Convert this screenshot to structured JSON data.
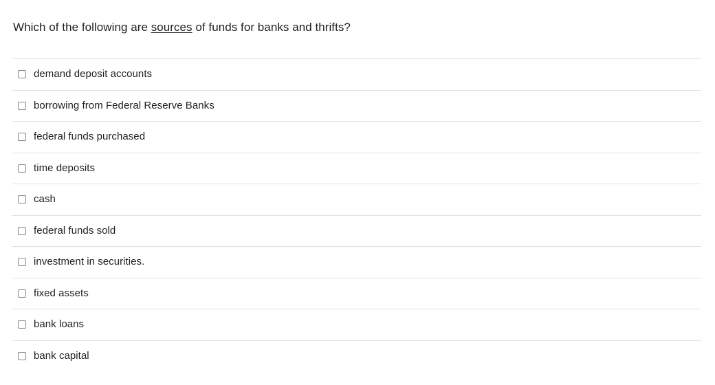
{
  "question": {
    "prefix": "Which of the following are ",
    "emphasis": "sources",
    "suffix": " of funds for banks and thrifts?"
  },
  "colors": {
    "background": "#ffffff",
    "text": "#201f1e",
    "divider": "#e1e1e1",
    "checkbox_border": "#8a8886"
  },
  "options": [
    {
      "label": "demand deposit accounts",
      "checked": false
    },
    {
      "label": "borrowing from Federal Reserve Banks",
      "checked": false
    },
    {
      "label": "federal funds purchased",
      "checked": false
    },
    {
      "label": "time deposits",
      "checked": false
    },
    {
      "label": "cash",
      "checked": false
    },
    {
      "label": "federal funds sold",
      "checked": false
    },
    {
      "label": "investment in securities.",
      "checked": false
    },
    {
      "label": "fixed assets",
      "checked": false
    },
    {
      "label": "bank loans",
      "checked": false
    },
    {
      "label": "bank capital",
      "checked": false
    }
  ]
}
